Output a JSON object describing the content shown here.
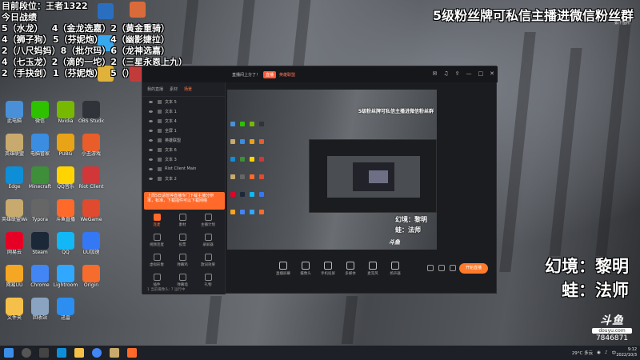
{
  "overlay": {
    "rank_line": "目前段位：王者1322",
    "today_label": "今日战绩",
    "records": [
      {
        "a": "5（水龙）",
        "b": "4（金龙选嘉）",
        "c": "2（黄金重骑）"
      },
      {
        "a": "4（狮子狗）",
        "b": "5（芬妮炮）",
        "c": "4（幽影婕拉）"
      },
      {
        "a": "2（八尺妈妈）",
        "b": "8（批尔玛）",
        "c": "6（龙神选嘉）"
      },
      {
        "a": "4（七玉龙）",
        "b": "2（滴的一坨）",
        "c": "2（三星永恩上九）"
      },
      {
        "a": "2（手抉剑）",
        "b": "1（芬妮炮）",
        "c": "5（）"
      }
    ],
    "banner": "5级粉丝牌可私信主播进微信粉丝群",
    "banner_sub": "如下图所",
    "skins": [
      "幻境：黎明",
      "蛙：法师"
    ],
    "platform_logo": "斗鱼",
    "platform_site": "douyu.com",
    "room_id": "7846871"
  },
  "desktop_icons": [
    {
      "label": "此电脑",
      "color": "#4a90d9"
    },
    {
      "label": "微信",
      "color": "#2dc100"
    },
    {
      "label": "Nvidia",
      "color": "#76b900"
    },
    {
      "label": "OBS Studio",
      "color": "#30343a"
    },
    {
      "label": "英雄联盟",
      "color": "#c8aa6e"
    },
    {
      "label": "电脑管家",
      "color": "#3a8de0"
    },
    {
      "label": "PUBG",
      "color": "#e8a317"
    },
    {
      "label": "小丑游戏",
      "color": "#e85d2a"
    },
    {
      "label": "Edge",
      "color": "#0f8ed8"
    },
    {
      "label": "Minecraft",
      "color": "#3e8e3a"
    },
    {
      "label": "QQ音乐",
      "color": "#ffd400"
    },
    {
      "label": "Riot Client",
      "color": "#d13639"
    },
    {
      "label": "英雄联盟WeGame",
      "color": "#c8aa6e"
    },
    {
      "label": "Typora",
      "color": "#666666"
    },
    {
      "label": "斗鱼直播",
      "color": "#ff6a2b"
    },
    {
      "label": "WeGame",
      "color": "#e04a2e"
    },
    {
      "label": "网易云",
      "color": "#e60026"
    },
    {
      "label": "Steam",
      "color": "#1b2838"
    },
    {
      "label": "QQ",
      "color": "#12b7f5"
    },
    {
      "label": "UU加速",
      "color": "#3478f6"
    },
    {
      "label": "网易UU",
      "color": "#f5a623"
    },
    {
      "label": "Chrome",
      "color": "#4285f4"
    },
    {
      "label": "Lightroom",
      "color": "#31a8ff"
    },
    {
      "label": "Origin",
      "color": "#f56c2d"
    },
    {
      "label": "文件夹",
      "color": "#f5c04a"
    },
    {
      "label": "回收站",
      "color": "#8aa3c0"
    },
    {
      "label": "迅雷",
      "color": "#2b8ef0"
    }
  ],
  "app": {
    "title": "直播间上分了！",
    "tag": "直播",
    "tag2": "英雄联盟",
    "tabs": [
      "我的直播",
      "素材",
      "场景"
    ],
    "active_tab": "场景",
    "layers": [
      "文本 5",
      "文本 1",
      "文本 4",
      "全屏 1",
      "英雄联盟",
      "文本 6",
      "文本 3",
      "Riot Client Main",
      "文本 2"
    ],
    "notice": "上周5日请暂停直播专门下载主播分辨 率，标准，下载插件可以下载网络",
    "tools": [
      "连麦",
      "素材",
      "主播计划",
      "视频连麦",
      "投票",
      "录屏器",
      "虚拟形象",
      "弹幕鸡",
      "歌词效果",
      "插件",
      "弹幕墙",
      "礼物"
    ],
    "active_tool": "连麦",
    "left_footer": "1 当前摄像头: 7 运行中",
    "bottom": [
      "直播屏幕",
      "摄像头",
      "手机投屏",
      "多媒体",
      "麦克风",
      "扬声器"
    ],
    "start_label": "开始直播",
    "preview_banner": "5级粉丝牌可私信主播进微信粉丝群",
    "preview_skins": [
      "幻境：黎明",
      "蛙：法师"
    ],
    "preview_logo": "斗鱼"
  },
  "taskbar": {
    "weather": "29°C 多云",
    "time": "9:12",
    "date": "2022/10/3"
  }
}
